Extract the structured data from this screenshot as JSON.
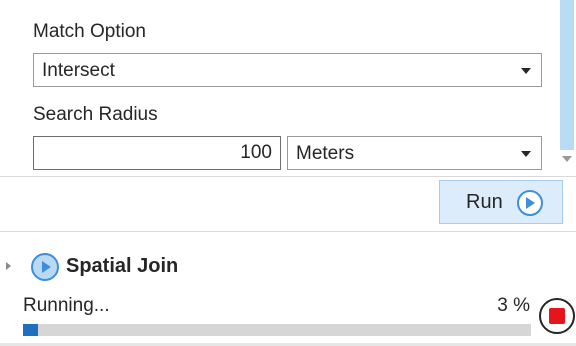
{
  "parameters": {
    "match_option": {
      "label": "Match Option",
      "value": "Intersect"
    },
    "search_radius": {
      "label": "Search Radius",
      "value": "100",
      "unit": "Meters"
    }
  },
  "run_button": {
    "label": "Run",
    "icon": "play-icon"
  },
  "history": {
    "tool_name": "Spatial Join",
    "status": "Running...",
    "progress_label": "3 %",
    "progress_fraction": 0.03,
    "stop_icon": "stop-icon"
  },
  "colors": {
    "accent": "#3e8fd9",
    "progress": "#1e6fbf",
    "stop": "#e8141b",
    "run_button_bg": "#dcecfb"
  }
}
